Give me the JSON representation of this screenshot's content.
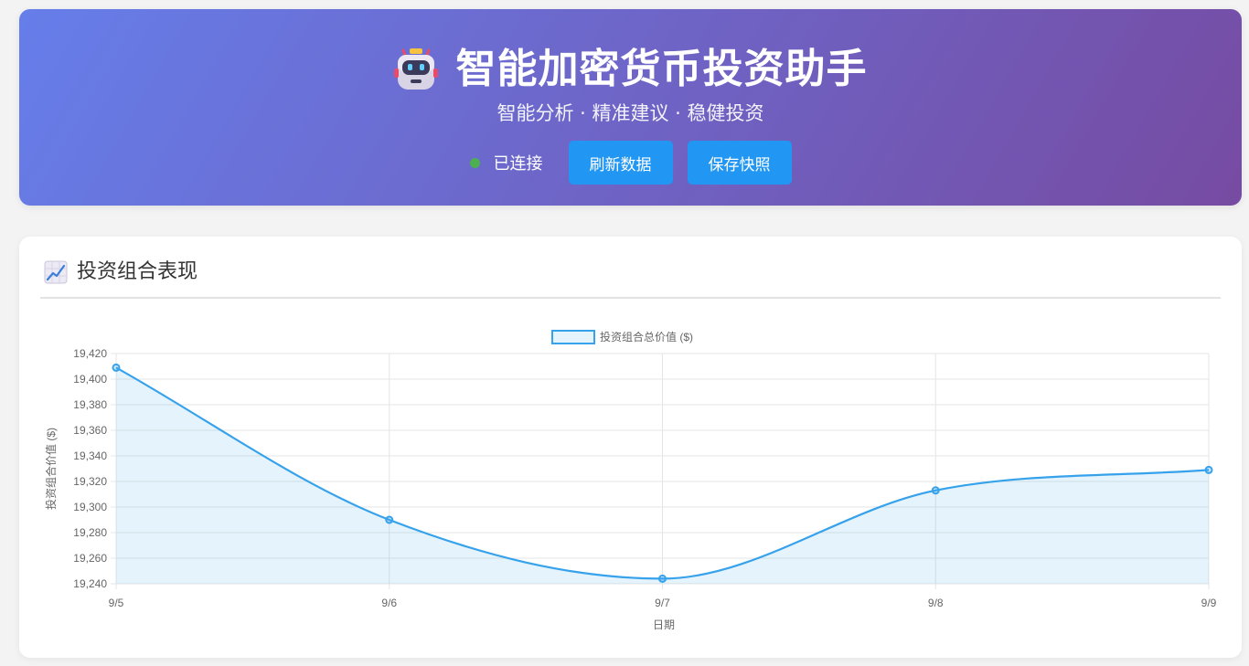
{
  "header": {
    "title": "智能加密货币投资助手",
    "subtitle": "智能分析 · 精准建议 · 稳健投资",
    "status_label": "已连接",
    "status_color": "#4caf50",
    "refresh_button": "刷新数据",
    "snapshot_button": "保存快照",
    "robot_icon": "robot-icon",
    "gradient": [
      "#667eea",
      "#764ba2"
    ],
    "button_color": "#2196f3"
  },
  "portfolio": {
    "title": "投资组合表现",
    "icon": "chart-increasing-icon"
  },
  "chart_data": {
    "type": "area",
    "categories": [
      "9/5",
      "9/6",
      "9/7",
      "9/8",
      "9/9"
    ],
    "series": [
      {
        "name": "投资组合总价值 ($)",
        "values": [
          19409,
          19290,
          19244,
          19313,
          19329
        ],
        "color": "#36a2eb"
      }
    ],
    "xlabel": "日期",
    "ylabel": "投资组合价值 ($)",
    "ylim": [
      19240,
      19420
    ],
    "yticks": [
      "19,420",
      "19,400",
      "19,380",
      "19,360",
      "19,340",
      "19,320",
      "19,300",
      "19,280",
      "19,260",
      "19,240"
    ],
    "grid": true,
    "legend": "top-center"
  }
}
